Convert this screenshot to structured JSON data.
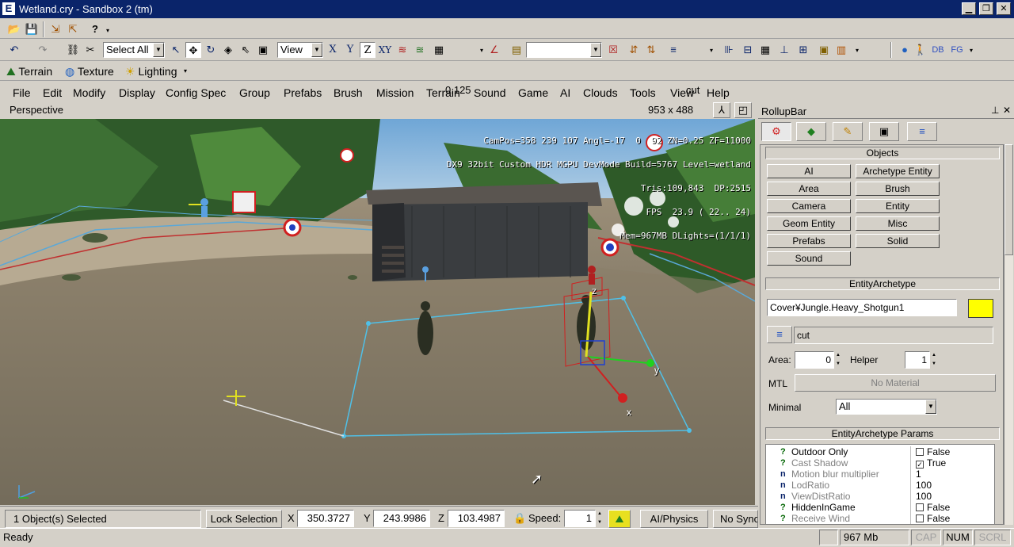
{
  "window": {
    "title": "Wetland.cry - Sandbox 2 (tm)",
    "app_icon": "E"
  },
  "toolbar1": {
    "select_label": "Select All",
    "view_label": "View",
    "axis_x": "X",
    "axis_y": "Y",
    "axis_z": "Z",
    "axis_xy": "XY",
    "grid_value": "0.125",
    "layer_value": "cut",
    "db": "DB",
    "fg": "FG"
  },
  "toolbar2": {
    "terrain": "Terrain",
    "texture": "Texture",
    "lighting": "Lighting"
  },
  "menu": [
    "File",
    "Edit",
    "Modify",
    "Display",
    "Config Spec",
    "Group",
    "Prefabs",
    "Brush",
    "Mission",
    "Terrain",
    "Sound",
    "Game",
    "AI",
    "Clouds",
    "Tools",
    "View",
    "Help"
  ],
  "viewport": {
    "name": "Perspective",
    "size": "953 x 488",
    "overlay": [
      "CamPos=358 239 107 Angl=-17  0  92 ZN=0.25 ZF=11000",
      "DX9 32bit Custom HDR MGPU DevMode Build=5767 Level=wetland",
      "Tris:109,843  DP:2515",
      "FPS  23.9 ( 22.. 24)",
      "Mem=967MB DLights=(1/1/1)"
    ],
    "gizmo": {
      "x": "x",
      "y": "y",
      "z": "z"
    }
  },
  "rollup": {
    "title": "RollupBar",
    "objects_header": "Objects",
    "buttons": [
      [
        "AI",
        "Archetype Entity"
      ],
      [
        "Area",
        "Brush"
      ],
      [
        "Camera",
        "Entity"
      ],
      [
        "Geom Entity",
        "Misc"
      ],
      [
        "Prefabs",
        "Solid"
      ],
      [
        "Sound",
        ""
      ]
    ],
    "archetype_header": "EntityArchetype",
    "archetype_name": "Cover¥Jungle.Heavy_Shotgun1",
    "archetype_color": "#ffff00",
    "layer": "cut",
    "area_label": "Area:",
    "area_value": "0",
    "helper_label": "Helper",
    "helper_value": "1",
    "mtl_label": "MTL",
    "mtl_value": "No Material",
    "minimal_label": "Minimal",
    "minimal_value": "All",
    "params_header": "EntityArchetype Params",
    "params": [
      {
        "t": "?",
        "name": "Outdoor Only",
        "cb": "",
        "value": "False"
      },
      {
        "t": "?",
        "name": "Cast Shadow",
        "cb": "✓",
        "value": "True"
      },
      {
        "t": "n",
        "name": "Motion blur multiplier",
        "cb": null,
        "value": "1"
      },
      {
        "t": "n",
        "name": "LodRatio",
        "cb": null,
        "value": "100"
      },
      {
        "t": "n",
        "name": "ViewDistRatio",
        "cb": null,
        "value": "100"
      },
      {
        "t": "?",
        "name": "HiddenInGame",
        "cb": "",
        "value": "False"
      },
      {
        "t": "?",
        "name": "Receive Wind",
        "cb": "",
        "value": "False"
      }
    ]
  },
  "status": {
    "selected": "1 Object(s) Selected",
    "lock": "Lock Selection",
    "x_label": "X",
    "x": "350.3727",
    "y_label": "Y",
    "y": "243.9986",
    "z_label": "Z",
    "z": "103.4987",
    "speed_label": "Speed:",
    "speed": "1",
    "ai": "AI/Physics",
    "nosync": "No Sync",
    "ready": "Ready",
    "mem": "967 Mb",
    "cap": "CAP",
    "num": "NUM",
    "scrl": "SCRL"
  }
}
